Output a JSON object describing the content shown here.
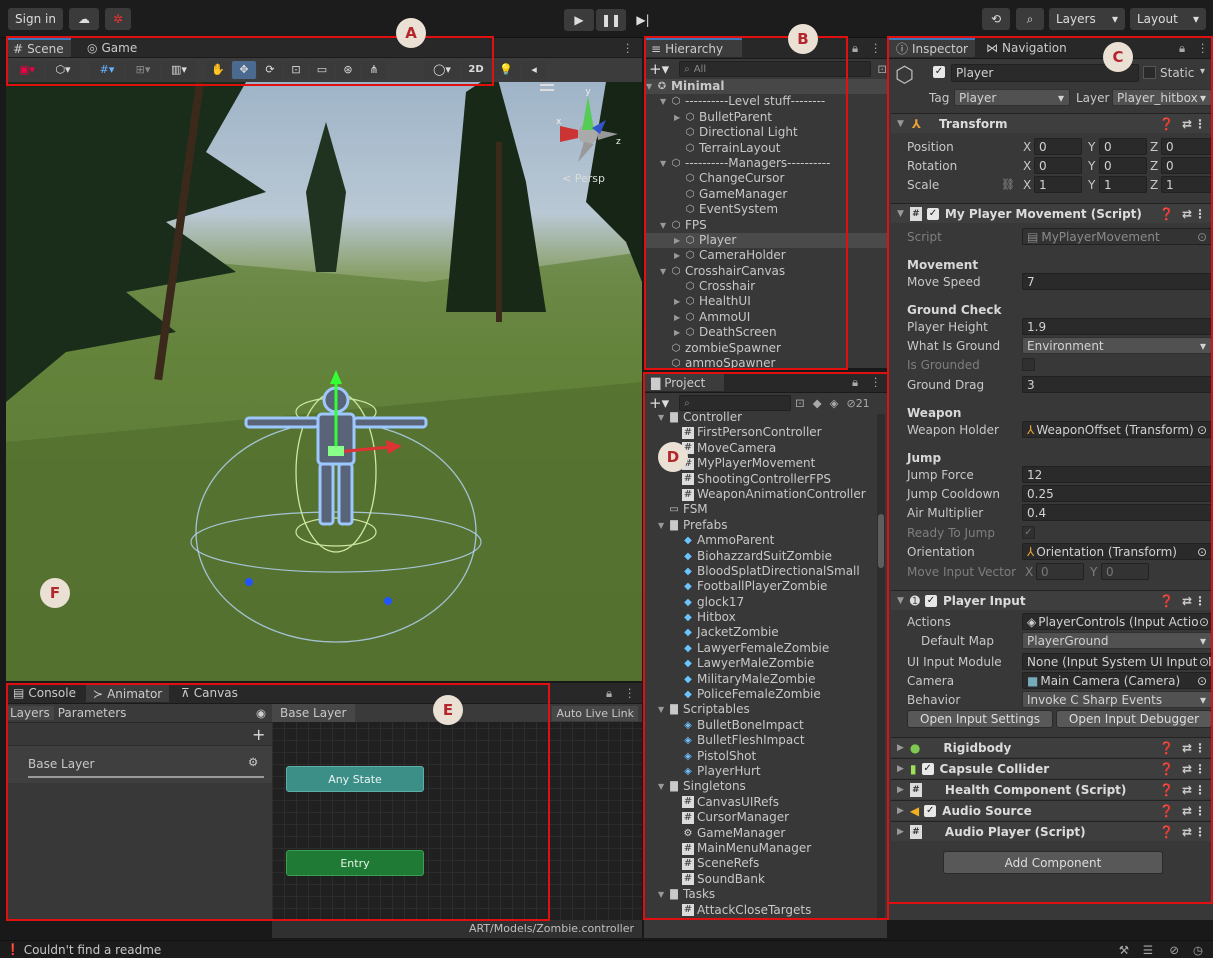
{
  "topbar": {
    "sign_in": "Sign in",
    "layers": "Layers",
    "layout": "Layout"
  },
  "scene": {
    "tab_scene": "Scene",
    "tab_game": "Game",
    "btn_2d": "2D",
    "persp": "< Persp",
    "gizmo_x": "x",
    "gizmo_y": "y",
    "gizmo_z": "z"
  },
  "hierarchy": {
    "title": "Hierarchy",
    "search_placeholder": "All",
    "items": [
      {
        "label": "Minimal",
        "indent": 0,
        "arrow": "▼",
        "icon": "unity-scene",
        "bold": true
      },
      {
        "label": "----------Level stuff--------",
        "indent": 1,
        "arrow": "▼",
        "icon": "cube"
      },
      {
        "label": "BulletParent",
        "indent": 2,
        "arrow": "▶",
        "icon": "cube"
      },
      {
        "label": "Directional Light",
        "indent": 2,
        "arrow": "",
        "icon": "cube"
      },
      {
        "label": "TerrainLayout",
        "indent": 2,
        "arrow": "",
        "icon": "cube"
      },
      {
        "label": "----------Managers----------",
        "indent": 1,
        "arrow": "▼",
        "icon": "cube"
      },
      {
        "label": "ChangeCursor",
        "indent": 2,
        "arrow": "",
        "icon": "cube"
      },
      {
        "label": "GameManager",
        "indent": 2,
        "arrow": "",
        "icon": "cube"
      },
      {
        "label": "EventSystem",
        "indent": 2,
        "arrow": "",
        "icon": "cube"
      },
      {
        "label": "FPS",
        "indent": 1,
        "arrow": "▼",
        "icon": "cube"
      },
      {
        "label": "Player",
        "indent": 2,
        "arrow": "▶",
        "icon": "cube",
        "selected": true
      },
      {
        "label": "CameraHolder",
        "indent": 2,
        "arrow": "▶",
        "icon": "cube"
      },
      {
        "label": "CrosshairCanvas",
        "indent": 1,
        "arrow": "▼",
        "icon": "cube"
      },
      {
        "label": "Crosshair",
        "indent": 2,
        "arrow": "",
        "icon": "cube"
      },
      {
        "label": "HealthUI",
        "indent": 2,
        "arrow": "▶",
        "icon": "cube"
      },
      {
        "label": "AmmoUI",
        "indent": 2,
        "arrow": "▶",
        "icon": "cube"
      },
      {
        "label": "DeathScreen",
        "indent": 2,
        "arrow": "▶",
        "icon": "cube"
      },
      {
        "label": "zombieSpawner",
        "indent": 1,
        "arrow": "",
        "icon": "cube"
      },
      {
        "label": "ammoSpawner",
        "indent": 1,
        "arrow": "",
        "icon": "cube"
      }
    ]
  },
  "project": {
    "title": "Project",
    "hidden_count": "21",
    "items": [
      {
        "label": "Controller",
        "indent": 1,
        "arrow": "▼",
        "icon": "folder"
      },
      {
        "label": "FirstPersonController",
        "indent": 2,
        "icon": "script"
      },
      {
        "label": "MoveCamera",
        "indent": 2,
        "icon": "script"
      },
      {
        "label": "MyPlayerMovement",
        "indent": 2,
        "icon": "script"
      },
      {
        "label": "ShootingControllerFPS",
        "indent": 2,
        "icon": "script"
      },
      {
        "label": "WeaponAnimationController",
        "indent": 2,
        "icon": "script"
      },
      {
        "label": "FSM",
        "indent": 1,
        "arrow": "",
        "icon": "folder-empty"
      },
      {
        "label": "Prefabs",
        "indent": 1,
        "arrow": "▼",
        "icon": "folder"
      },
      {
        "label": "AmmoParent",
        "indent": 2,
        "icon": "prefab"
      },
      {
        "label": "BiohazzardSuitZombie",
        "indent": 2,
        "icon": "prefab"
      },
      {
        "label": "BloodSplatDirectionalSmall",
        "indent": 2,
        "icon": "prefab"
      },
      {
        "label": "FootballPlayerZombie",
        "indent": 2,
        "icon": "prefab"
      },
      {
        "label": "glock17",
        "indent": 2,
        "icon": "prefab"
      },
      {
        "label": "Hitbox",
        "indent": 2,
        "icon": "prefab"
      },
      {
        "label": "JacketZombie",
        "indent": 2,
        "icon": "prefab"
      },
      {
        "label": "LawyerFemaleZombie",
        "indent": 2,
        "icon": "prefab"
      },
      {
        "label": "LawyerMaleZombie",
        "indent": 2,
        "icon": "prefab"
      },
      {
        "label": "MilitaryMaleZombie",
        "indent": 2,
        "icon": "prefab"
      },
      {
        "label": "PoliceFemaleZombie",
        "indent": 2,
        "icon": "prefab"
      },
      {
        "label": "Scriptables",
        "indent": 1,
        "arrow": "▼",
        "icon": "folder"
      },
      {
        "label": "BulletBoneImpact",
        "indent": 2,
        "icon": "scriptable"
      },
      {
        "label": "BulletFleshImpact",
        "indent": 2,
        "icon": "scriptable"
      },
      {
        "label": "PistolShot",
        "indent": 2,
        "icon": "scriptable"
      },
      {
        "label": "PlayerHurt",
        "indent": 2,
        "icon": "scriptable"
      },
      {
        "label": "Singletons",
        "indent": 1,
        "arrow": "▼",
        "icon": "folder"
      },
      {
        "label": "CanvasUIRefs",
        "indent": 2,
        "icon": "script"
      },
      {
        "label": "CursorManager",
        "indent": 2,
        "icon": "script"
      },
      {
        "label": "GameManager",
        "indent": 2,
        "icon": "gear"
      },
      {
        "label": "MainMenuManager",
        "indent": 2,
        "icon": "script"
      },
      {
        "label": "SceneRefs",
        "indent": 2,
        "icon": "script"
      },
      {
        "label": "SoundBank",
        "indent": 2,
        "icon": "script"
      },
      {
        "label": "Tasks",
        "indent": 1,
        "arrow": "▼",
        "icon": "folder"
      },
      {
        "label": "AttackCloseTargets",
        "indent": 2,
        "icon": "script"
      }
    ]
  },
  "inspector": {
    "tab_inspector": "Inspector",
    "tab_navigation": "Navigation",
    "name": "Player",
    "static_label": "Static",
    "tag_label": "Tag",
    "tag_value": "Player",
    "layer_label": "Layer",
    "layer_value": "Player_hitbox",
    "transform": {
      "title": "Transform",
      "position": "Position",
      "rotation": "Rotation",
      "scale": "Scale",
      "pos": [
        "0",
        "0",
        "0"
      ],
      "rot": [
        "0",
        "0",
        "0"
      ],
      "scl": [
        "1",
        "1",
        "1"
      ],
      "x": "X",
      "y": "Y",
      "z": "Z"
    },
    "movement": {
      "title": "My Player Movement (Script)",
      "script_label": "Script",
      "script_value": "MyPlayerMovement",
      "sec_movement": "Movement",
      "move_speed_label": "Move Speed",
      "move_speed": "7",
      "sec_ground": "Ground Check",
      "player_height_label": "Player Height",
      "player_height": "1.9",
      "what_is_ground_label": "What Is Ground",
      "what_is_ground": "Environment",
      "is_grounded_label": "Is Grounded",
      "ground_drag_label": "Ground Drag",
      "ground_drag": "3",
      "sec_weapon": "Weapon",
      "weapon_holder_label": "Weapon Holder",
      "weapon_holder": "WeaponOffset (Transform)",
      "sec_jump": "Jump",
      "jump_force_label": "Jump Force",
      "jump_force": "12",
      "jump_cooldown_label": "Jump Cooldown",
      "jump_cooldown": "0.25",
      "air_mult_label": "Air Multiplier",
      "air_mult": "0.4",
      "ready_label": "Ready To Jump",
      "orientation_label": "Orientation",
      "orientation": "Orientation (Transform)",
      "move_input_label": "Move Input Vector",
      "mi_x": "0",
      "mi_y": "0"
    },
    "player_input": {
      "title": "Player Input",
      "actions_label": "Actions",
      "actions": "PlayerControls (Input Action",
      "default_map_label": "Default Map",
      "default_map": "PlayerGround",
      "ui_module_label": "UI Input Module",
      "ui_module": "None (Input System UI Input Mc",
      "camera_label": "Camera",
      "camera": "Main Camera (Camera)",
      "behavior_label": "Behavior",
      "behavior": "Invoke C Sharp Events",
      "open_settings": "Open Input Settings",
      "open_debugger": "Open Input Debugger"
    },
    "components": [
      "Rigidbody",
      "Capsule Collider",
      "Health Component (Script)",
      "Audio Source",
      "Audio Player (Script)"
    ],
    "add_component": "Add Component"
  },
  "bottom": {
    "tab_console": "Console",
    "tab_animator": "Animator",
    "tab_canvas": "Canvas",
    "layers": "Layers",
    "parameters": "Parameters",
    "base_layer": "Base Layer",
    "breadcrumb": "Base Layer",
    "auto_live_link": "Auto Live Link",
    "any_state": "Any State",
    "entry": "Entry",
    "path": "ART/Models/Zombie.controller"
  },
  "status": {
    "message": "Couldn't find a readme"
  },
  "badges": [
    "A",
    "B",
    "C",
    "D",
    "E",
    "F"
  ],
  "colors": {
    "accent": "#3a79bb",
    "highlight": "#e01010",
    "entry": "#1d7a3a",
    "any_state": "#3a8f88"
  }
}
